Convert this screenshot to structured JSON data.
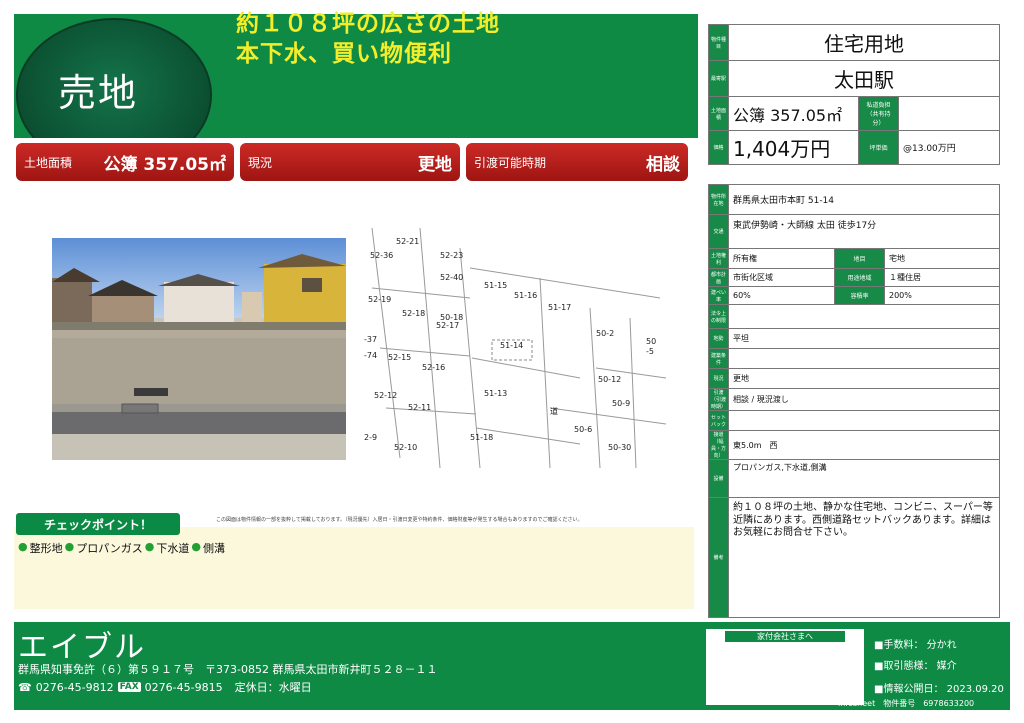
{
  "header": {
    "title": "売地",
    "headline_1": "約１０８坪の広さの土地",
    "headline_2": "本下水、買い物便利"
  },
  "summary": {
    "area_label": "土地面積",
    "area_value": "公簿 357.05㎡",
    "status_label": "現況",
    "status_value": "更地",
    "handover_label": "引渡可能時期",
    "handover_value": "相談"
  },
  "map": {
    "labels": [
      "52-21",
      "52-36",
      "52-23",
      "52-40",
      "51-15",
      "51-16",
      "51-17",
      "52-19",
      "52-18",
      "50-18",
      "52-17",
      "50-2",
      "50",
      "-5",
      "-37",
      "51-14",
      "-74",
      "52-15",
      "52-16",
      "50-12",
      "52-12",
      "51-13",
      "50-9",
      "52-11",
      "道",
      "50-6",
      "2-9",
      "52-10",
      "51-18",
      "50-30"
    ]
  },
  "disclaimer": "この図面は物件情報の一部を抜粋して掲載しております。（現況優先）入居日・引渡日変更や特約条件、価格財産等が発生する場合もありますのでご確認ください。",
  "check": {
    "badge": "チェックポイント！",
    "items": [
      "整形地",
      "プロパンガス",
      "下水道",
      "側溝"
    ]
  },
  "table_top": {
    "h_type": "物件種目",
    "type": "住宅用地",
    "h_station": "最寄駅",
    "station": "太田駅",
    "h_area": "土地面積",
    "area": "公簿 357.05㎡",
    "h_private_road": "私道負担（共有持分）",
    "h_price": "価格",
    "price": "1,404万円",
    "h_unit_price": "坪単価",
    "unit_price": "@13.00万円"
  },
  "table_bottom": {
    "h_location": "物件所在地",
    "location": "群馬県太田市本町 51-14",
    "h_transport": "交通",
    "transport": "東武伊勢崎・大師線 太田 徒歩17分",
    "h_rights": "土地権利",
    "rights": "所有権",
    "h_category": "地目",
    "category": "宅地",
    "h_city_plan": "都市計画",
    "city_plan": "市街化区域",
    "h_zoning": "用途地域",
    "zoning": "１種住居",
    "h_bcr": "建ぺい率",
    "bcr": "60%",
    "h_far": "容積率",
    "far": "200%",
    "h_law": "法令上の制限",
    "h_terrain": "地勢",
    "terrain": "平坦",
    "h_construction": "建築条件",
    "h_current": "現況",
    "current": "更地",
    "h_handover": "引渡（引渡時期）",
    "handover": "相談 / 現況渡し",
    "h_setback": "セットバック",
    "h_road": "接道（幅員・方向）",
    "road": "東5.0m　西",
    "h_facilities": "設備",
    "facilities": "プロパンガス,下水道,側溝",
    "h_remarks": "備考",
    "remarks": "約１０８坪の土地、静かな住宅地、コンビニ、スーパー等近隣にあります。西側道路セットバックあります。詳細はお気軽にお問合せ下さい。"
  },
  "footer": {
    "company": "エイブル",
    "license": "群馬県知事免許（６）第５９１７号　〒373-0852 群馬県太田市新井町５２８－１１",
    "tel": "0276-45-9812",
    "fax_tag": "FAX",
    "fax": "0276-45-9815",
    "holiday": "定休日：水曜日",
    "destination_label": "家付会社さまへ",
    "fee_1": "■手数料：  分かれ",
    "fee_2": "■取引態様：  媒介",
    "fee_3": "■情報公開日：  2023.09.20",
    "sheet": "infosheet　物件番号　6978633200"
  },
  "colors": {
    "brand_green": "#0e8a45",
    "headline_yellow": "#f4ee2a",
    "accent_red": "#b81e1a"
  }
}
